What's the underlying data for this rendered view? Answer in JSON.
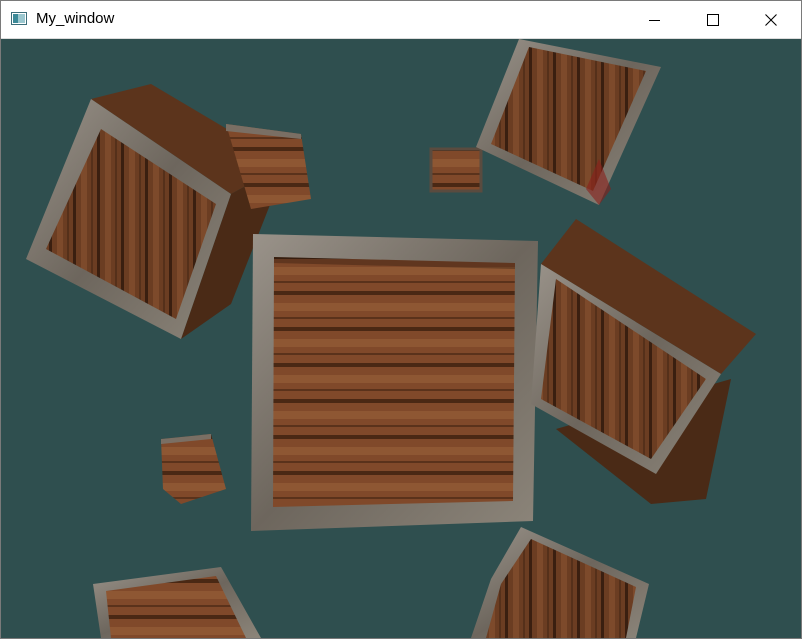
{
  "window": {
    "title": "My_window",
    "controls": [
      "minimize-icon",
      "maximize-icon",
      "close-icon"
    ]
  },
  "scene": {
    "clear_color": "#2f4f4f",
    "crate_wood_color": "#6e3f22",
    "crate_frame_color": "#7c756c"
  }
}
